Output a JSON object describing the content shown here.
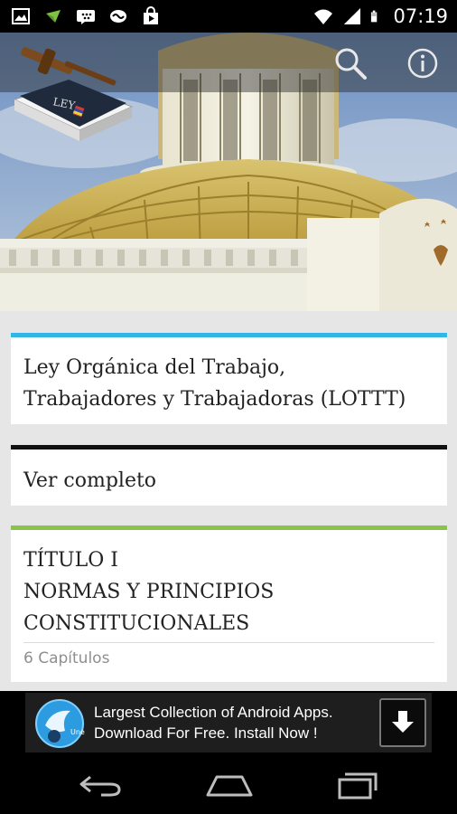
{
  "status_bar": {
    "time": "07:19",
    "icons": [
      "image-icon",
      "app-icon",
      "bbm-icon",
      "sync-icon",
      "store-icon",
      "wifi-icon",
      "signal-icon",
      "battery-icon"
    ]
  },
  "header": {
    "actions": [
      "search-icon",
      "info-icon"
    ]
  },
  "cards": [
    {
      "lines": [
        "Ley Orgánica del Trabajo,",
        "Trabajadores y Trabajadoras (LOTTT)"
      ],
      "accent": "#33b5e5"
    },
    {
      "lines": [
        "Ver completo"
      ],
      "accent": "#111111"
    },
    {
      "lines": [
        "TÍTULO I",
        "NORMAS Y PRINCIPIOS",
        "CONSTITUCIONALES"
      ],
      "meta": "6 Capítulos",
      "accent": "#8bc34a"
    }
  ],
  "ad": {
    "line1": "Largest Collection of Android Apps.",
    "line2": "Download For Free. Install Now !",
    "icon_caption": "Une"
  },
  "navbar": [
    "back-icon",
    "home-icon",
    "recents-icon"
  ]
}
